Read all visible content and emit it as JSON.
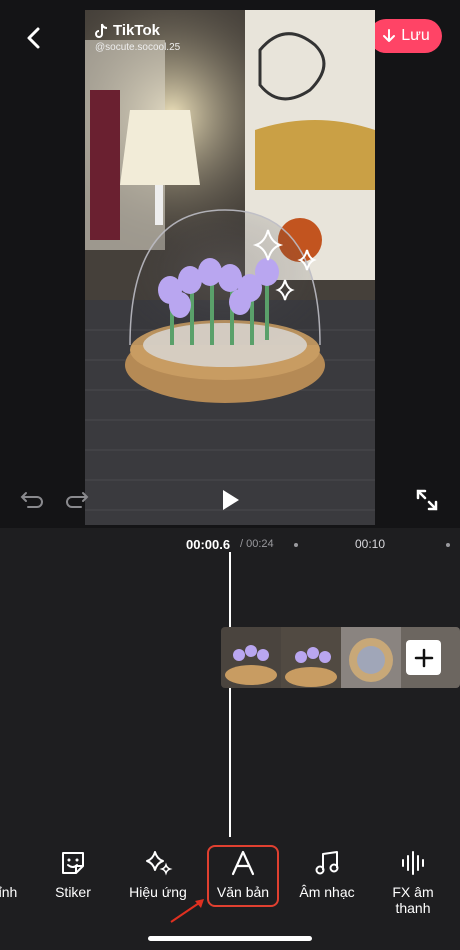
{
  "header": {
    "save_label": "Lưu"
  },
  "watermark": {
    "brand": "TikTok",
    "handle": "@socute.socool.25"
  },
  "timeline": {
    "current_time": "00:00.6",
    "total_time": "/ 00:24",
    "marker_time": "00:10"
  },
  "toolbar": {
    "items": [
      {
        "label": "ỉnh",
        "icon": "adjust-icon"
      },
      {
        "label": "Stiker",
        "icon": "sticker-icon"
      },
      {
        "label": "Hiệu ứng",
        "icon": "sparkle-icon"
      },
      {
        "label": "Văn bản",
        "icon": "text-icon",
        "highlighted": true
      },
      {
        "label": "Âm nhạc",
        "icon": "music-icon"
      },
      {
        "label": "FX âm thanh",
        "icon": "sound-fx-icon"
      }
    ]
  },
  "colors": {
    "accent": "#ff4466",
    "highlight": "#e04030",
    "background": "#1e1e20"
  }
}
